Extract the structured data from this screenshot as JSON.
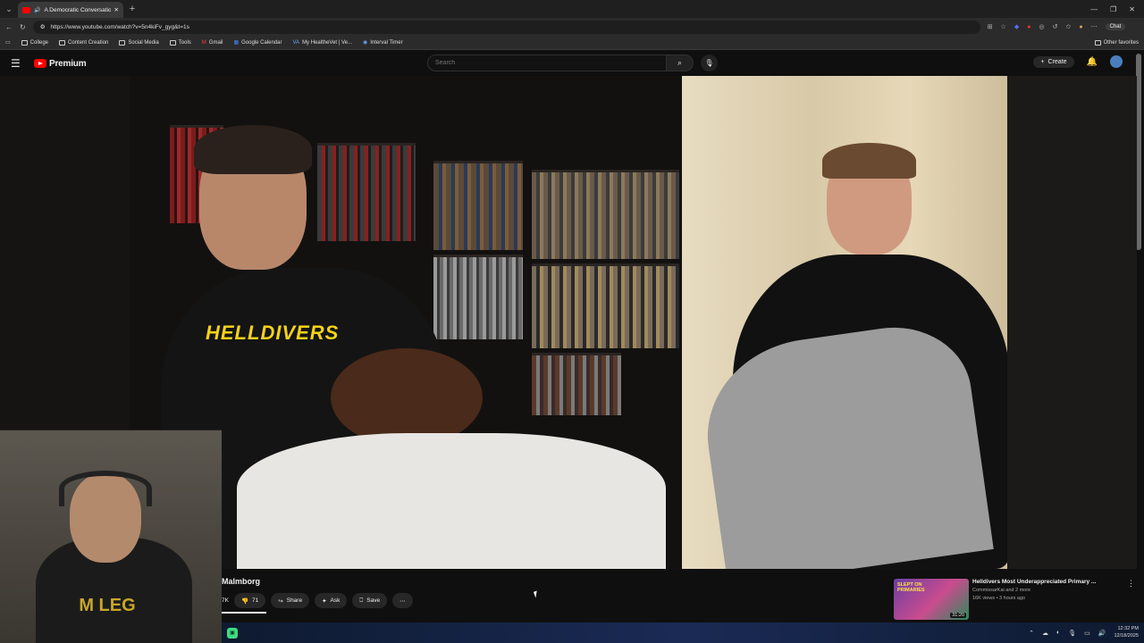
{
  "browser": {
    "tab_title": "A Democratic Conversation w",
    "url": "https://www.youtube.com/watch?v=5n4kiFv_gyg&t=1s",
    "chat_label": "Chat",
    "bookmarks": [
      "College",
      "Content Creation",
      "Social Media",
      "Tools",
      "Gmail",
      "Google Calendar",
      "My HealtheVet | Ve...",
      "Interval Timer"
    ],
    "other_favorites": "Other favorites"
  },
  "youtube": {
    "logo_text": "Premium",
    "search_placeholder": "Search",
    "create_label": "Create"
  },
  "video": {
    "title_fragment": "Malmborg",
    "likes_fragment": "7K",
    "dislike_count": "71",
    "share_label": "Share",
    "ask_label": "Ask",
    "save_label": "Save",
    "shirt_left": "HELLDIVERS"
  },
  "recommendation": {
    "title": "Helldivers Most Underappreciated Primary ...",
    "channel": "CommissarKai and 2 more",
    "meta": "16K views • 3 hours ago",
    "duration": "31:20",
    "thumb_text": "SLEPT ON PRIMARIES"
  },
  "taskbar": {
    "time": "12:32 PM",
    "date": "12/18/2025"
  }
}
